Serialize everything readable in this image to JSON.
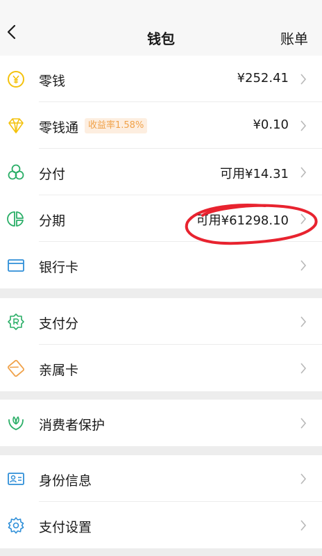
{
  "header": {
    "title": "钱包",
    "right_link": "账单"
  },
  "groups": [
    {
      "items": [
        {
          "label": "零钱",
          "value": "¥252.41",
          "icon": "coin-icon",
          "color": "#f4c20d"
        },
        {
          "label": "零钱通",
          "badge": "收益率1.58%",
          "value": "¥0.10",
          "icon": "diamond-icon",
          "color": "#f4c20d"
        },
        {
          "label": "分付",
          "value": "可用¥14.31",
          "icon": "circles-icon",
          "color": "#2aae67"
        },
        {
          "label": "分期",
          "value": "可用¥61298.10",
          "icon": "pie-icon",
          "color": "#2aae67"
        },
        {
          "label": "银行卡",
          "value": "",
          "icon": "card-icon",
          "color": "#2f8fd8"
        }
      ]
    },
    {
      "items": [
        {
          "label": "支付分",
          "value": "",
          "icon": "badge-icon",
          "color": "#2aae67"
        },
        {
          "label": "亲属卡",
          "value": "",
          "icon": "family-card-icon",
          "color": "#f0a24a"
        }
      ]
    },
    {
      "items": [
        {
          "label": "消费者保护",
          "value": "",
          "icon": "protect-icon",
          "color": "#2aae67"
        }
      ]
    },
    {
      "items": [
        {
          "label": "身份信息",
          "value": "",
          "icon": "id-card-icon",
          "color": "#2f8fd8"
        },
        {
          "label": "支付设置",
          "value": "",
          "icon": "gear-icon",
          "color": "#2f8fd8"
        }
      ]
    }
  ],
  "annotation": {
    "color": "#e8232f"
  }
}
